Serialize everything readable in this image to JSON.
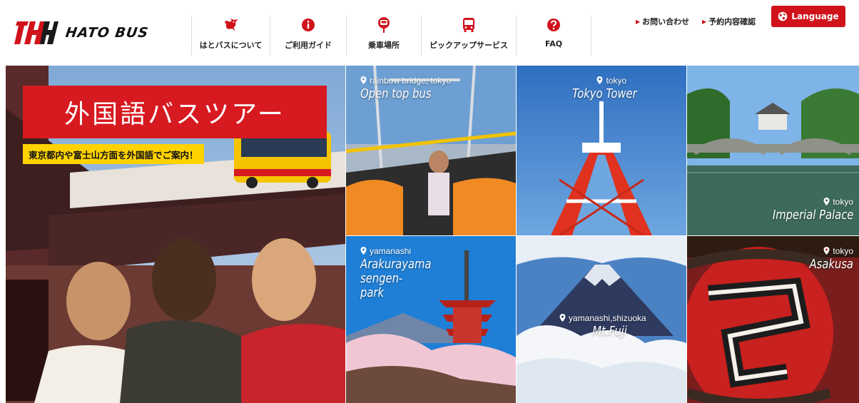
{
  "brand": {
    "logo_text": "HATO BUS",
    "color_red": "#d0121b",
    "color_yellow": "#ffd200"
  },
  "nav": {
    "items": [
      {
        "label": "はとバスについて",
        "icon": "hato-bird-icon"
      },
      {
        "label": "ご利用ガイド",
        "icon": "info-icon"
      },
      {
        "label": "乗車場所",
        "icon": "bus-stop-icon"
      },
      {
        "label": "ピックアップサービス",
        "icon": "bus-front-icon"
      },
      {
        "label": "FAQ",
        "icon": "question-icon"
      }
    ]
  },
  "utility": {
    "contact": "お問い合わせ",
    "reservation": "予約内容確認"
  },
  "language": {
    "label": "Language",
    "icon": "globe-icon"
  },
  "hero": {
    "title": "外国語バスツアー",
    "subtitle": "東京都内や富士山方面を外国語でご案内！"
  },
  "tiles": [
    {
      "location": "rainbow bridge, tokyo",
      "name": "Open top bus"
    },
    {
      "location": "tokyo",
      "name": "Tokyo Tower"
    },
    {
      "location": "tokyo",
      "name": "Imperial Palace"
    },
    {
      "location": "yamanashi",
      "name": "Arakurayama sengen-park"
    },
    {
      "location": "yamanashi,shizuoka",
      "name": "Mt.Fuji"
    },
    {
      "location": "tokyo",
      "name": "Asakusa"
    }
  ]
}
